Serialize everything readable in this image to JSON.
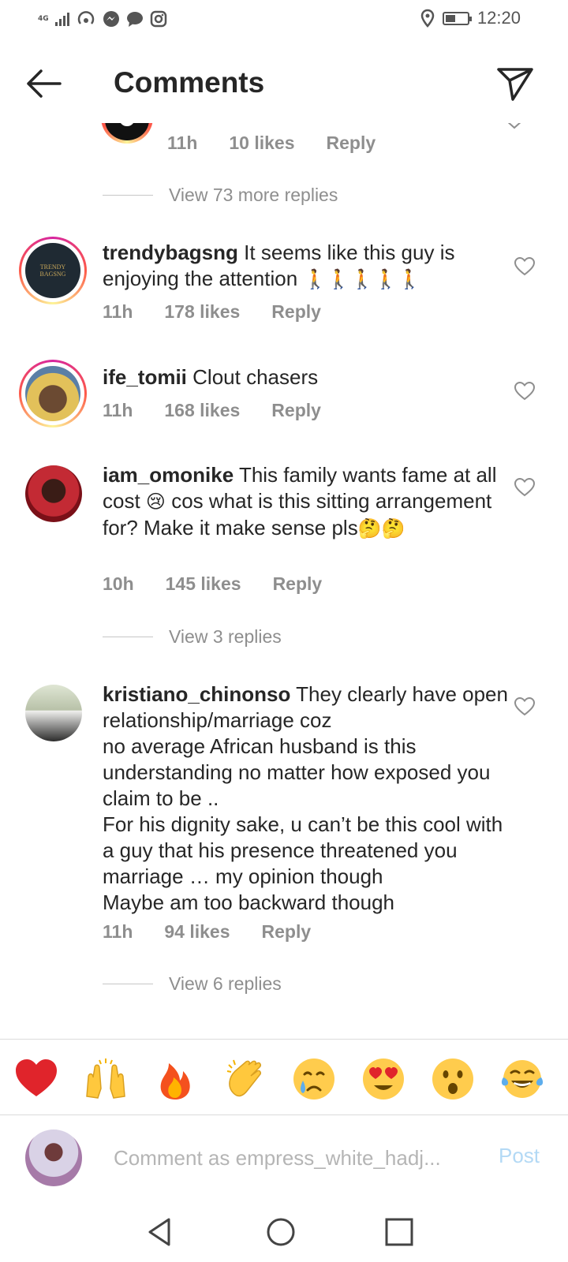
{
  "status_bar": {
    "network": "4G",
    "time": "12:20",
    "battery_level": 0.45
  },
  "header": {
    "title": "Comments"
  },
  "top_comment_meta": {
    "time": "11h",
    "likes": "10 likes",
    "reply": "Reply"
  },
  "view_more_1": "View 73 more replies",
  "comments": [
    {
      "username": "trendybagsng",
      "text": "It seems like this guy is enjoying the attention",
      "emoji": "🚶🚶🚶🚶🚶",
      "time": "11h",
      "likes": "178 likes",
      "reply": "Reply",
      "avatar_text": "TRENDY BAGSNG"
    },
    {
      "username": "ife_tomii",
      "text": "Clout chasers",
      "time": "11h",
      "likes": "168 likes",
      "reply": "Reply"
    },
    {
      "username": "iam_omonike",
      "text_a": "This family wants fame at all cost",
      "emoji_a": "😢",
      "text_b": "cos what is this sitting arrangement for? Make it make sense pls",
      "emoji_b": "🤔🤔",
      "time": "10h",
      "likes": "145 likes",
      "reply": "Reply",
      "view_replies": "View 3 replies"
    },
    {
      "username": "kristiano_chinonso",
      "lines": [
        "They clearly have open relationship/marriage coz",
        "no average African husband is this understanding no matter how exposed you claim to be ..",
        " For his dignity sake, u can’t be this cool with a guy that his presence threatened you marriage … my opinion though",
        " Maybe am too backward though"
      ],
      "time": "11h",
      "likes": "94 likes",
      "reply": "Reply",
      "view_replies": "View 6 replies"
    }
  ],
  "emoji_bar": [
    "❤️",
    "🙌",
    "🔥",
    "👏",
    "😢",
    "😍",
    "😮",
    "😂"
  ],
  "input": {
    "placeholder": "Comment as empress_white_hadj...",
    "post_label": "Post"
  },
  "colors": {
    "text": "#262626",
    "meta": "#8e8e8e",
    "post_disabled": "#b3d9f5",
    "heart_red": "#e0242b"
  }
}
